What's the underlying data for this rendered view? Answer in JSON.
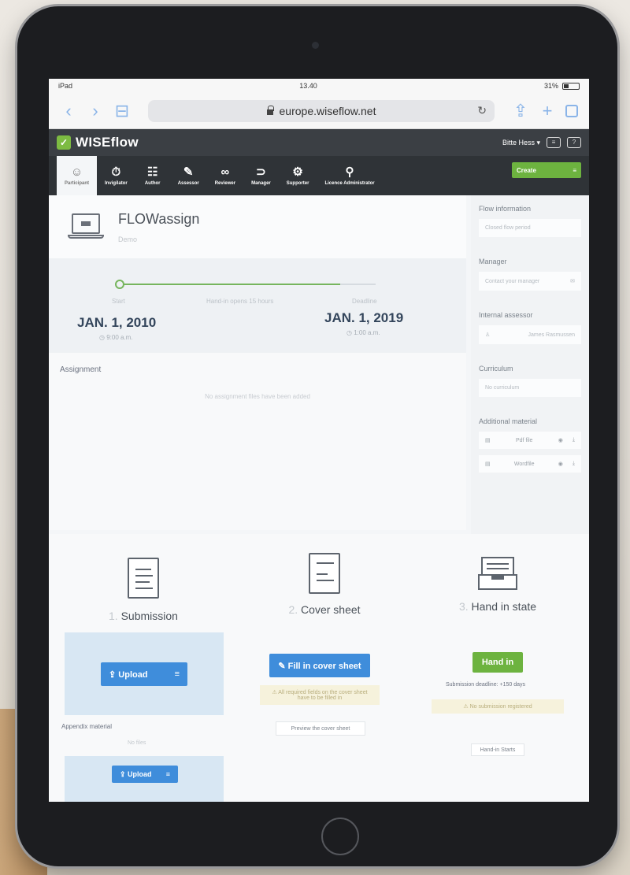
{
  "status": {
    "carrier": "iPad",
    "time": "13.40",
    "battery": "31%"
  },
  "browser": {
    "url": "europe.wiseflow.net"
  },
  "app": {
    "logo": "WISEflow",
    "user_name": "Bitte Hess",
    "roles": [
      {
        "label": "Participant",
        "icon": "person-icon"
      },
      {
        "label": "Invigilator",
        "icon": "stopwatch-icon"
      },
      {
        "label": "Author",
        "icon": "author-icon"
      },
      {
        "label": "Assessor",
        "icon": "assessor-icon"
      },
      {
        "label": "Reviewer",
        "icon": "reviewer-icon"
      },
      {
        "label": "Manager",
        "icon": "manager-icon"
      },
      {
        "label": "Supporter",
        "icon": "supporter-icon"
      },
      {
        "label": "Licence Administrator",
        "icon": "admin-icon"
      }
    ],
    "create_label": "Create"
  },
  "flow": {
    "name": "FLOWassign",
    "subtitle": "Demo",
    "timeline": {
      "start_label": "Start",
      "middle_label": "Hand-in opens 15 hours",
      "end_label": "Deadline",
      "start_date": "JAN. 1, 2010",
      "start_time": "9:00 a.m.",
      "end_date": "JAN. 1, 2019",
      "end_time": "1:00 a.m."
    },
    "assignment": {
      "title": "Assignment",
      "empty": "No assignment files have been added"
    }
  },
  "sidebar": {
    "title": "Flow information",
    "status_value": "Closed flow period",
    "manager_title": "Manager",
    "manager_value": "Contact your manager",
    "assessor_title": "Internal assessor",
    "assessor_value": "James Rasmussen",
    "curriculum_title": "Curriculum",
    "curriculum_value": "No curriculum",
    "material_title": "Additional material",
    "materials": [
      "Pdf file",
      "Wordfile"
    ]
  },
  "steps": [
    {
      "num": "1.",
      "label": "Submission",
      "button": "Upload",
      "appendix_label": "Appendix material",
      "appendix_note": "No files",
      "appendix_button": "Upload"
    },
    {
      "num": "2.",
      "label": "Cover sheet",
      "button": "Fill in cover sheet",
      "notice": "All required fields on the cover sheet have to be filled in",
      "preview": "Preview the cover sheet"
    },
    {
      "num": "3.",
      "label": "Hand in state",
      "button": "Hand in",
      "deadline": "Submission deadline: +150 days",
      "notice": "No submission registered",
      "footer_button": "Hand-in Starts"
    }
  ],
  "colors": {
    "accent_green": "#6db33f",
    "primary_blue": "#3f8ddb",
    "header_dark": "#3b3f44"
  }
}
